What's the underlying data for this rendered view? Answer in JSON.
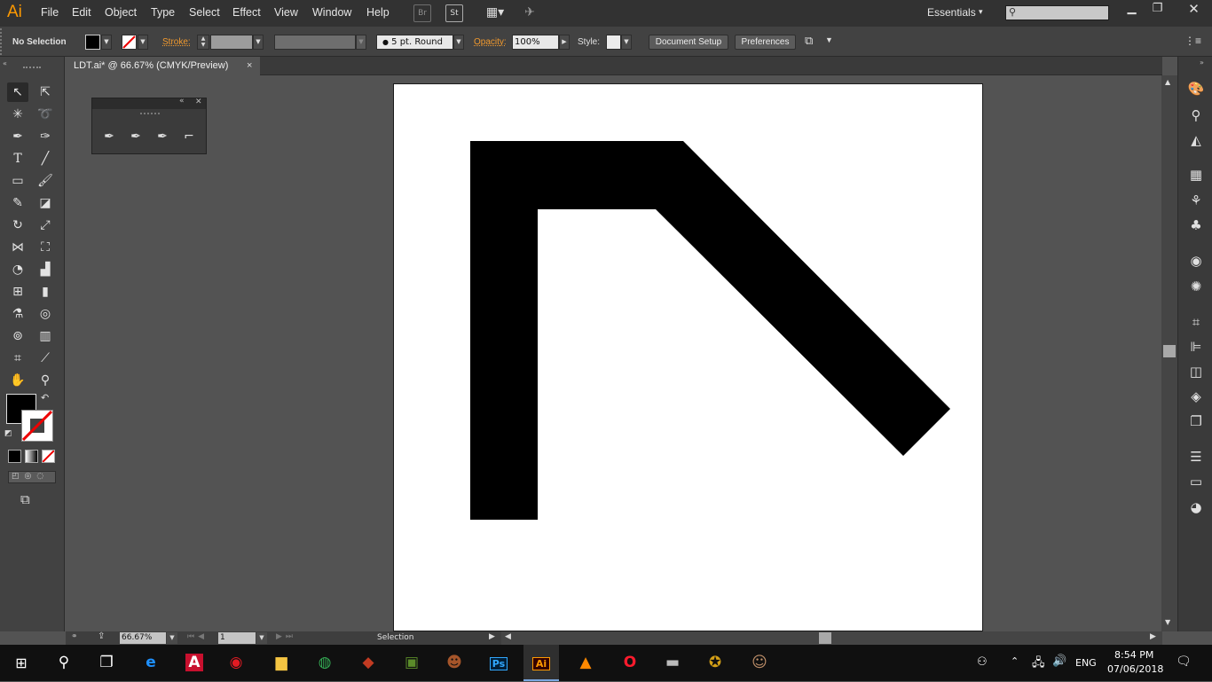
{
  "app": {
    "logo": "Ai",
    "menu": [
      "File",
      "Edit",
      "Object",
      "Type",
      "Select",
      "Effect",
      "View",
      "Window",
      "Help"
    ],
    "bridge_icon": "Br",
    "stock_icon": "St",
    "workspace": "Essentials",
    "search_placeholder": ""
  },
  "control_bar": {
    "selection": "No Selection",
    "stroke_label": "Stroke:",
    "brush": "5 pt. Round",
    "opacity_label": "Opacity:",
    "opacity_value": "100%",
    "style_label": "Style:",
    "document_setup": "Document Setup",
    "preferences": "Preferences"
  },
  "document": {
    "tab_title": "LDT.ai* @ 66.67% (CMYK/Preview)",
    "tab_close": "×"
  },
  "status": {
    "zoom": "66.67%",
    "artboard": "1",
    "tool": "Selection"
  },
  "taskbar": {
    "time": "8:54 PM",
    "date": "07/06/2018",
    "lang": "ENG"
  },
  "colors": {
    "accent_orange": "#ff9a00",
    "shape_fill": "#000000",
    "artboard": "#ffffff",
    "ps_blue": "#31a8ff",
    "ai_orange": "#ff9a00"
  }
}
